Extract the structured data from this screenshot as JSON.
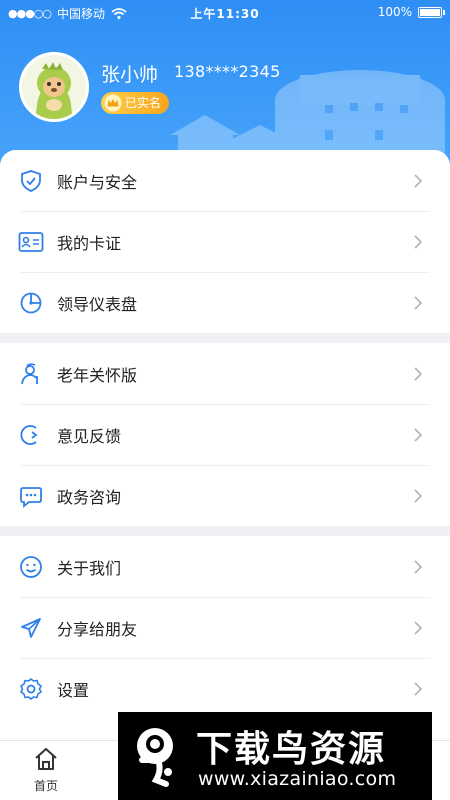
{
  "status_bar": {
    "signal_dots": "●●●○○",
    "carrier": "中国移动",
    "time": "上午11:30",
    "battery": "100%"
  },
  "profile": {
    "name": "张小帅",
    "phone": "138****2345",
    "verified_badge": "已实名"
  },
  "menu_groups": [
    [
      {
        "label": "账户与安全",
        "icon": "shield-check-icon"
      },
      {
        "label": "我的卡证",
        "icon": "id-card-icon"
      },
      {
        "label": "领导仪表盘",
        "icon": "dashboard-icon"
      }
    ],
    [
      {
        "label": "老年关怀版",
        "icon": "elderly-care-icon"
      },
      {
        "label": "意见反馈",
        "icon": "feedback-icon"
      },
      {
        "label": "政务咨询",
        "icon": "chat-icon"
      }
    ],
    [
      {
        "label": "关于我们",
        "icon": "smile-icon"
      },
      {
        "label": "分享给朋友",
        "icon": "share-icon"
      },
      {
        "label": "设置",
        "icon": "settings-gear-icon"
      }
    ]
  ],
  "tabbar": {
    "home_label": "首页"
  },
  "watermark": {
    "title": "下载鸟资源",
    "url": "www.xiazainiao.com"
  },
  "colors": {
    "header_blue": "#3a97f6",
    "accent": "#2e7fe8",
    "badge_gold": "#f7a51c"
  }
}
